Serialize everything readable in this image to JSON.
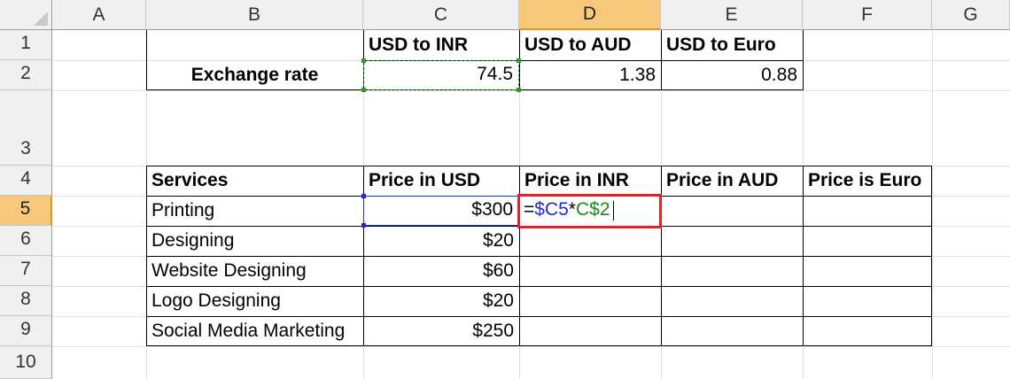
{
  "columns": [
    "A",
    "B",
    "C",
    "D",
    "E",
    "F",
    "G"
  ],
  "rows": [
    "1",
    "2",
    "3",
    "4",
    "5",
    "6",
    "7",
    "8",
    "9",
    "10"
  ],
  "selected_column": "D",
  "selected_row": "5",
  "exchange_table": {
    "headers": [
      "USD to INR",
      "USD to AUD",
      "USD to Euro"
    ],
    "label": "Exchange rate",
    "values": [
      "74.5",
      "1.38",
      "0.88"
    ]
  },
  "services_table": {
    "headers": [
      "Services",
      "Price in USD",
      "Price in INR",
      "Price in AUD",
      "Price is Euro"
    ],
    "rows": [
      {
        "service": "Printing",
        "usd": "$300"
      },
      {
        "service": "Designing",
        "usd": "$20"
      },
      {
        "service": "Website Designing",
        "usd": "$60"
      },
      {
        "service": "Logo Designing",
        "usd": "$20"
      },
      {
        "service": "Social Media Marketing",
        "usd": "$250"
      }
    ]
  },
  "formula_edit": {
    "cell": "D5",
    "eq": "=",
    "ref1": "$C5",
    "op": "*",
    "ref2": "C$2"
  },
  "colors": {
    "selection_header": "#f7c87a",
    "edit_highlight": "#e8202a",
    "ref_blue": "#1f2bd8",
    "ref_green": "#1a8a1a"
  }
}
